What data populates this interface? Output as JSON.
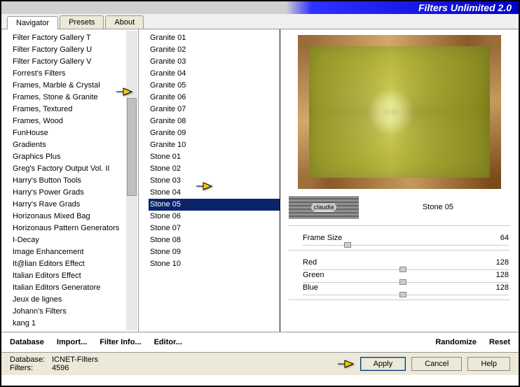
{
  "title": "Filters Unlimited 2.0",
  "tabs": {
    "navigator": "Navigator",
    "presets": "Presets",
    "about": "About"
  },
  "categories": [
    "Filter Factory Gallery T",
    "Filter Factory Gallery U",
    "Filter Factory Gallery V",
    "Forrest's Filters",
    "Frames, Marble & Crystal",
    "Frames, Stone & Granite",
    "Frames, Textured",
    "Frames, Wood",
    "FunHouse",
    "Gradients",
    "Graphics Plus",
    "Greg's Factory Output Vol. II",
    "Harry's Button Tools",
    "Harry's Power Grads",
    "Harry's Rave Grads",
    "Horizonaus Mixed Bag",
    "Horizonaus Pattern Generators",
    "I-Decay",
    "Image Enhancement",
    "It@lian Editors Effect",
    "Italian Editors Effect",
    "Italian Editors Generatore",
    "Jeux de lignes",
    "Johann's Filters",
    "kang 1"
  ],
  "selected_category_index": 5,
  "filters": [
    "Granite 01",
    "Granite 02",
    "Granite 03",
    "Granite 04",
    "Granite 05",
    "Granite 06",
    "Granite 07",
    "Granite 08",
    "Granite 09",
    "Granite 10",
    "Stone 01",
    "Stone 02",
    "Stone 03",
    "Stone 04",
    "Stone 05",
    "Stone 06",
    "Stone 07",
    "Stone 08",
    "Stone 09",
    "Stone 10"
  ],
  "selected_filter_index": 14,
  "stamp": "claudia",
  "current_filter": "Stone 05",
  "params": {
    "frame_size": {
      "label": "Frame Size",
      "value": 64,
      "pct": 25
    },
    "red": {
      "label": "Red",
      "value": 128,
      "pct": 50
    },
    "green": {
      "label": "Green",
      "value": 128,
      "pct": 50
    },
    "blue": {
      "label": "Blue",
      "value": 128,
      "pct": 50
    }
  },
  "bottom": {
    "database": "Database",
    "import": "Import...",
    "filter_info": "Filter Info...",
    "editor": "Editor...",
    "randomize": "Randomize",
    "reset": "Reset"
  },
  "status": {
    "db_label": "Database:",
    "db_value": "ICNET-Filters",
    "filters_label": "Filters:",
    "filters_value": "4596"
  },
  "buttons": {
    "apply": "Apply",
    "cancel": "Cancel",
    "help": "Help"
  }
}
